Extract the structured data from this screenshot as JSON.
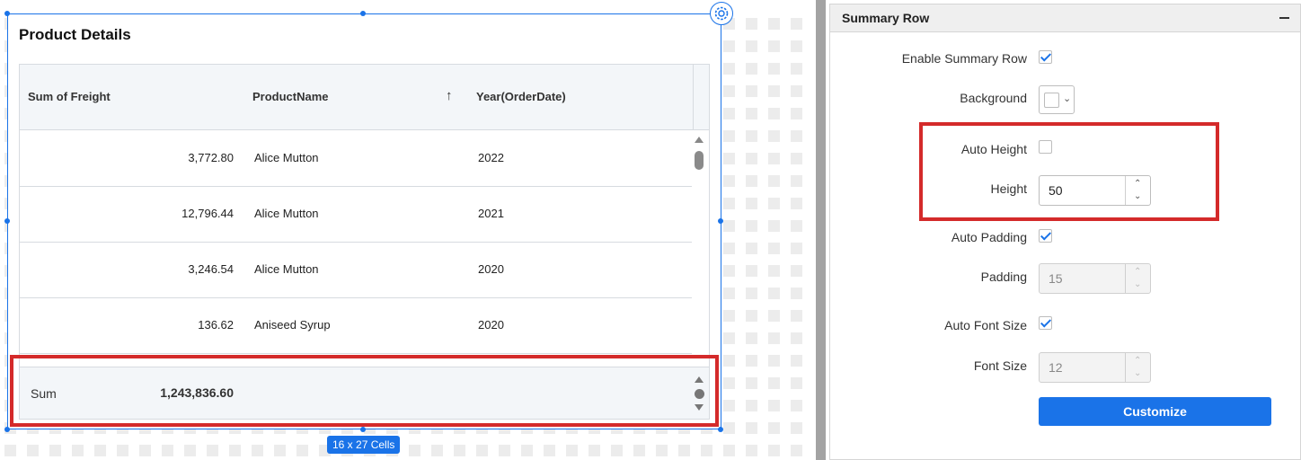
{
  "widget": {
    "title": "Product Details",
    "columns": [
      "Sum of Freight",
      "ProductName",
      "Year(OrderDate)"
    ],
    "rows": [
      {
        "freight": "3,772.80",
        "product": "Alice Mutton",
        "year": "2022"
      },
      {
        "freight": "12,796.44",
        "product": "Alice Mutton",
        "year": "2021"
      },
      {
        "freight": "3,246.54",
        "product": "Alice Mutton",
        "year": "2020"
      },
      {
        "freight": "136.62",
        "product": "Aniseed Syrup",
        "year": "2020"
      }
    ],
    "summary": {
      "label": "Sum",
      "value": "1,243,836.60"
    },
    "cells_badge": "16 x 27 Cells",
    "sort_icon": "arrow-up-icon"
  },
  "panel": {
    "title": "Summary Row",
    "enable_summary_row": {
      "label": "Enable Summary Row",
      "checked": true
    },
    "background": {
      "label": "Background",
      "color": "#ffffff"
    },
    "auto_height": {
      "label": "Auto Height",
      "checked": false
    },
    "height": {
      "label": "Height",
      "value": "50"
    },
    "auto_padding": {
      "label": "Auto Padding",
      "checked": true
    },
    "padding": {
      "label": "Padding",
      "value": "15"
    },
    "auto_font_size": {
      "label": "Auto Font Size",
      "checked": true
    },
    "font_size": {
      "label": "Font Size",
      "value": "12"
    },
    "customize_label": "Customize"
  },
  "colors": {
    "accent": "#1a73e8",
    "highlight": "#d42a2a"
  }
}
